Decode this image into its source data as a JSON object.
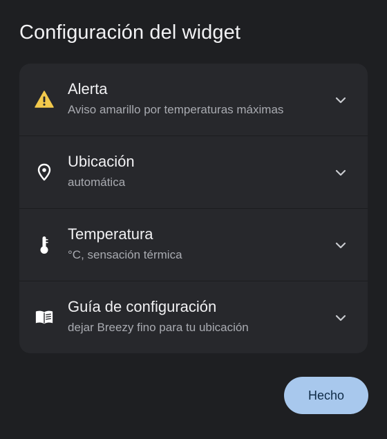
{
  "dialog": {
    "title": "Configuración del widget"
  },
  "settings": [
    {
      "icon": "warning-icon",
      "label": "Alerta",
      "value": "Aviso amarillo por temperaturas máximas"
    },
    {
      "icon": "location-pin-icon",
      "label": "Ubicación",
      "value": "automática"
    },
    {
      "icon": "thermometer-icon",
      "label": "Temperatura",
      "value": "°C, sensación térmica"
    },
    {
      "icon": "book-icon",
      "label": "Guía de configuración",
      "value": "dejar Breezy fino para tu ubicación"
    }
  ],
  "actions": {
    "done_label": "Hecho"
  },
  "colors": {
    "background": "#1e1f22",
    "list_background": "#27282c",
    "warning": "#f2c94c",
    "button": "#a8c8ed",
    "button_text": "#0e2a46"
  }
}
